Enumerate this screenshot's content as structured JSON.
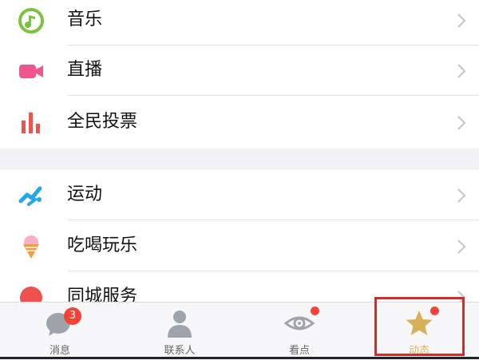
{
  "menu": {
    "section1": [
      {
        "label": "音乐",
        "icon": "music-note-icon"
      },
      {
        "label": "直播",
        "icon": "video-camera-icon"
      },
      {
        "label": "全民投票",
        "icon": "bar-chart-icon"
      }
    ],
    "section2": [
      {
        "label": "运动",
        "icon": "running-person-icon"
      },
      {
        "label": "吃喝玩乐",
        "icon": "ice-cream-icon"
      },
      {
        "label": "同城服务",
        "icon": "red-circle-icon"
      }
    ]
  },
  "tabbar": {
    "tabs": [
      {
        "label": "消息",
        "icon": "chat-bubble-icon",
        "badge": "3"
      },
      {
        "label": "联系人",
        "icon": "contact-person-icon"
      },
      {
        "label": "看点",
        "icon": "eye-icon",
        "has_dot": true
      },
      {
        "label": "动态",
        "icon": "star-icon",
        "has_dot": true,
        "active": true
      }
    ]
  },
  "colors": {
    "accent_active": "#e0b35a",
    "badge_red": "#f44336",
    "highlight_border": "#d32b2b"
  }
}
